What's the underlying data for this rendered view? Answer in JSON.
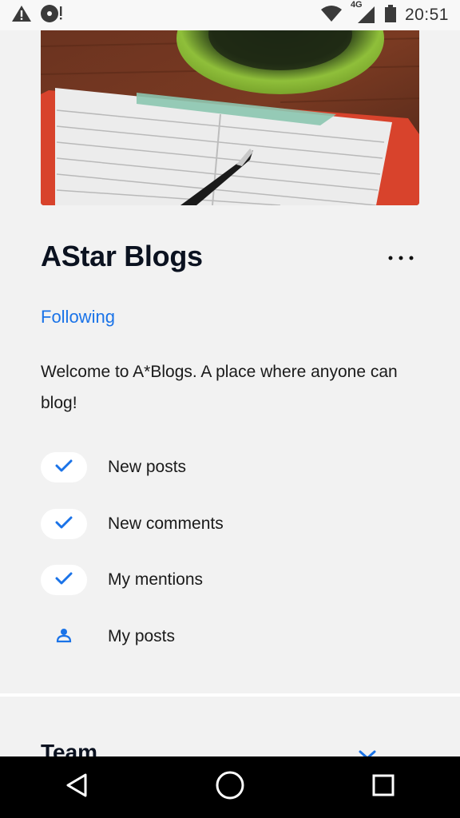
{
  "status_bar": {
    "time": "20:51",
    "network": "4G",
    "icons": [
      "warning-icon",
      "media-notification-icon",
      "wifi-icon",
      "cell-signal-icon",
      "battery-icon"
    ]
  },
  "blog": {
    "title": "AStar Blogs",
    "follow_state": "Following",
    "description": "Welcome to A*Blogs. A place where anyone can blog!"
  },
  "notification_prefs": [
    {
      "label": "New posts",
      "icon": "check-icon",
      "checked": true
    },
    {
      "label": "New comments",
      "icon": "check-icon",
      "checked": true
    },
    {
      "label": "My mentions",
      "icon": "check-icon",
      "checked": true
    },
    {
      "label": "My posts",
      "icon": "person-icon",
      "checked": false
    }
  ],
  "team_section": {
    "title": "Team"
  },
  "colors": {
    "accent": "#1a73e8",
    "background": "#f2f2f2",
    "title": "#0b1220"
  }
}
